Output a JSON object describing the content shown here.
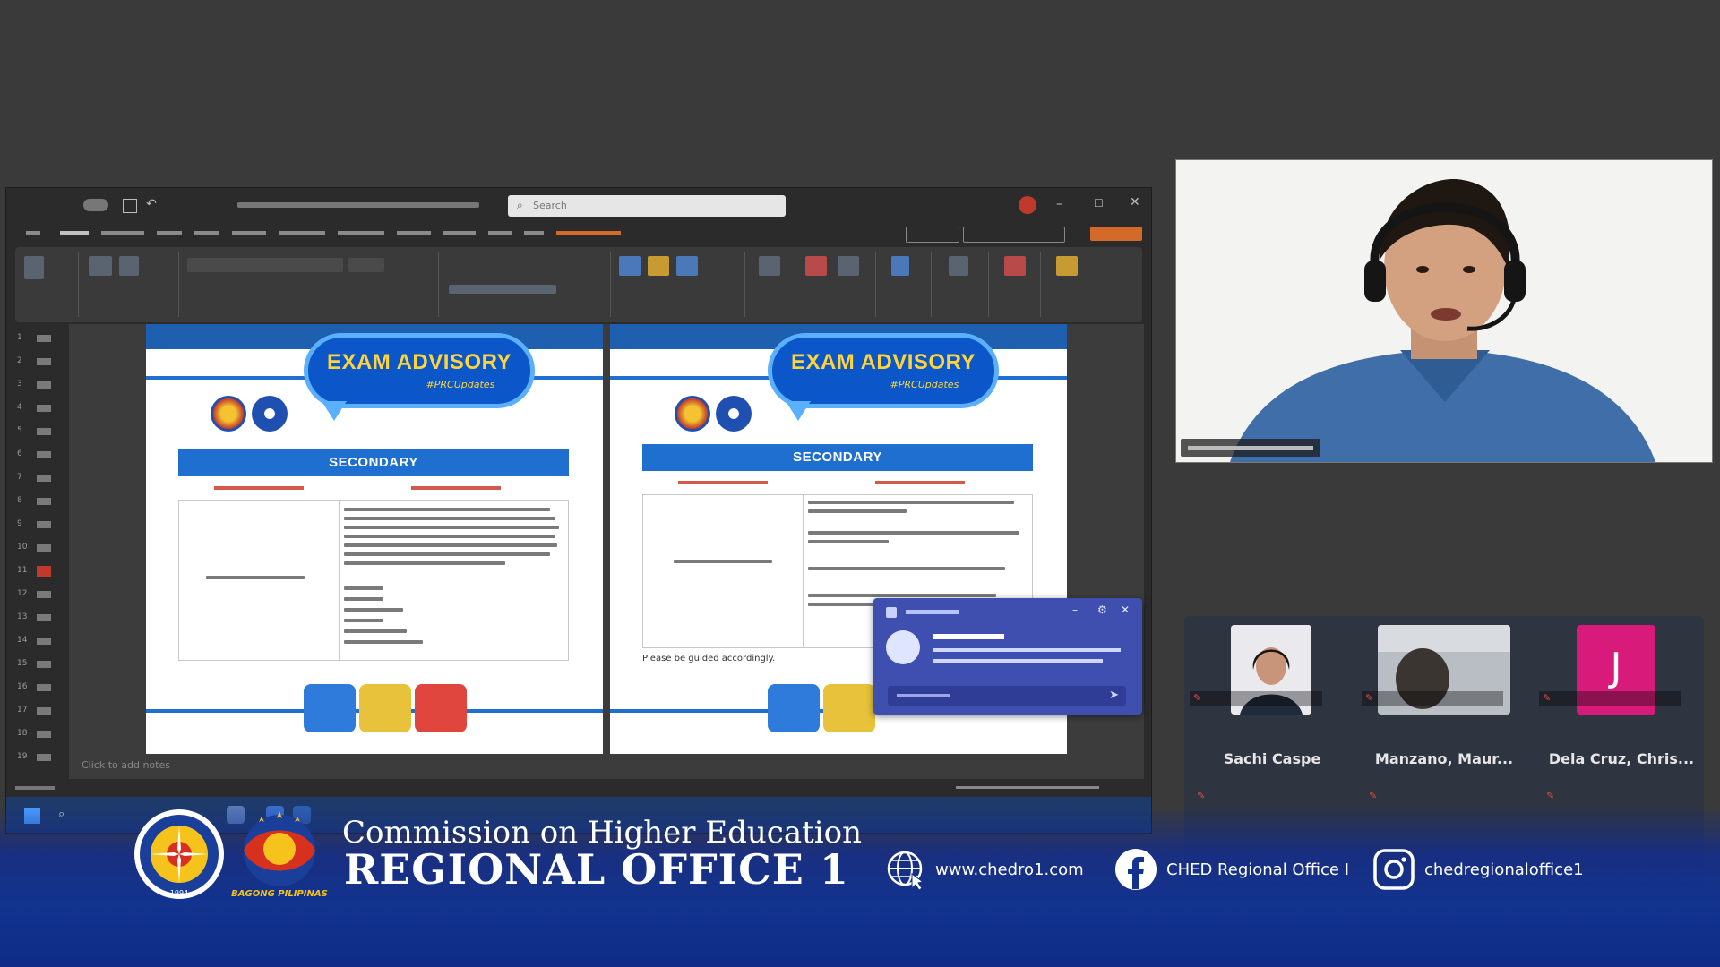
{
  "ppt": {
    "search_placeholder": "Search",
    "status_left": "Click to add notes"
  },
  "slides": [
    {
      "bubble_title": "EXAM ADVISORY",
      "bubble_sub": "#PRCUpdates",
      "table_title": "SECONDARY"
    },
    {
      "bubble_title": "EXAM ADVISORY",
      "bubble_sub": "#PRCUpdates",
      "table_title": "SECONDARY",
      "footer_note": "Please be guided accordingly."
    }
  ],
  "participants": [
    {
      "name": "Sachi Caspe"
    },
    {
      "name": "Manzano, Maur..."
    },
    {
      "name": "Dela Cruz, Chris...",
      "initial": "J"
    }
  ],
  "banner": {
    "title_line1": "Commission on Higher Education",
    "title_line2": "REGIONAL OFFICE 1",
    "logo_caption": "BAGONG PILIPINAS",
    "website": "www.chedro1.com",
    "facebook": "CHED Regional Office I",
    "instagram": "chedregionaloffice1",
    "seal_year": "1994"
  },
  "colors": {
    "banner_blue": "#12338f",
    "slide_blue": "#1f6fd0",
    "advisory_yellow": "#ffd43b",
    "initial_tile": "#d81b7a"
  }
}
